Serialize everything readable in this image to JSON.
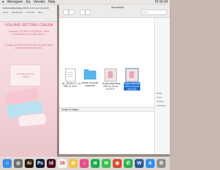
{
  "menubar": {
    "apple_icon": "apple-icon",
    "items": [
      "Weergave",
      "Ga",
      "Venster",
      "Help"
    ],
    "right_text": "Di 16:34"
  },
  "browser": {
    "title": "Schermafbeelding 2020-11-16 om 16.34.52",
    "tabs": [
      "Home",
      "Bestellingen",
      "Formulier",
      "Blog"
    ],
    "product": {
      "heading": "VOLUME SETTING CREAM",
      "paragraph1": "Contains GLYCERYL STEARATE, which moisturizes and creates volume.",
      "paragraph2": "Contains HYDROXYETHYLCELLULOSE, which provides volume and curls.",
      "box_label": "VOLUME SETTING CREAM"
    }
  },
  "finder": {
    "title": "Bureaublad",
    "search_placeholder": "Zoek",
    "files": [
      {
        "label": "AE_PRODUCT_vis 2020-11-16.m",
        "kind": "doc-icon"
      },
      {
        "label": "Belofte productie ontwerpen",
        "kind": "folder-icon"
      },
      {
        "label": "Schermafbeelding 2020-11-16 om 16.34.17",
        "kind": "screenshot-icon"
      },
      {
        "label": "Schermafbeelding 2020-11-16 om 16.34.52",
        "kind": "screenshot-icon",
        "selected": true
      }
    ],
    "section_label": "Vorige 30 dagen",
    "side_items": [
      "Naam",
      "Soort",
      "Grootte",
      "Gewijzigd"
    ]
  },
  "dock": {
    "apps": [
      {
        "name": "finder",
        "icon": "finder-icon",
        "color": "#3a8ee6",
        "glyph": "☺"
      },
      {
        "name": "launchpad",
        "icon": "launchpad-icon",
        "color": "#6d6d6d",
        "glyph": "◎"
      },
      {
        "name": "illustrator",
        "icon": "illustrator-icon",
        "color": "#2b1c02",
        "glyph": "Ai"
      },
      {
        "name": "photoshop",
        "icon": "photoshop-icon",
        "color": "#0a1f3a",
        "glyph": "Ps"
      },
      {
        "name": "indesign",
        "icon": "indesign-icon",
        "color": "#4a0a24",
        "glyph": "Id"
      },
      {
        "name": "calendar",
        "icon": "calendar-icon",
        "color": "#f4f4f4",
        "glyph": "16"
      },
      {
        "name": "photos",
        "icon": "photos-icon",
        "color": "#f6c343",
        "glyph": "✿"
      },
      {
        "name": "itunes",
        "icon": "itunes-icon",
        "color": "#e84d8a",
        "glyph": "♪"
      },
      {
        "name": "spotify",
        "icon": "spotify-icon",
        "color": "#1ab04c",
        "glyph": "≋"
      },
      {
        "name": "messages",
        "icon": "messages-icon",
        "color": "#37c24a",
        "glyph": "✉"
      },
      {
        "name": "chrome",
        "icon": "chrome-icon",
        "color": "#e3432f",
        "glyph": "◉"
      },
      {
        "name": "whatsapp",
        "icon": "whatsapp-icon",
        "color": "#2ab34a",
        "glyph": "✆"
      },
      {
        "name": "word",
        "icon": "word-icon",
        "color": "#2b579a",
        "glyph": "W"
      },
      {
        "name": "app-store",
        "icon": "appstore-icon",
        "color": "#2f8ef0",
        "glyph": "A"
      },
      {
        "name": "settings",
        "icon": "settings-icon",
        "color": "#8d8d8d",
        "glyph": "⚙"
      }
    ]
  }
}
